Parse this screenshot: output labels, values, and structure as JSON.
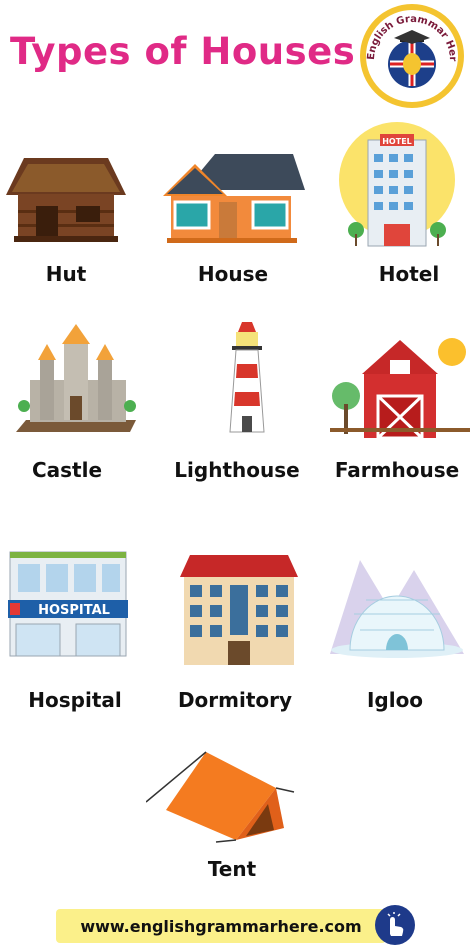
{
  "title": "Types of Houses",
  "logo": {
    "text": "English Grammar Here.Com"
  },
  "items": [
    {
      "label": "Hut",
      "icon": "hut-icon"
    },
    {
      "label": "House",
      "icon": "house-icon"
    },
    {
      "label": "Hotel",
      "icon": "hotel-icon",
      "sign": "HOTEL"
    },
    {
      "label": "Castle",
      "icon": "castle-icon"
    },
    {
      "label": "Lighthouse",
      "icon": "lighthouse-icon"
    },
    {
      "label": "Farmhouse",
      "icon": "farmhouse-icon"
    },
    {
      "label": "Hospital",
      "icon": "hospital-icon",
      "sign": "HOSPITAL"
    },
    {
      "label": "Dormitory",
      "icon": "dormitory-icon"
    },
    {
      "label": "Igloo",
      "icon": "igloo-icon"
    },
    {
      "label": "Tent",
      "icon": "tent-icon"
    }
  ],
  "footer": {
    "url": "www.englishgrammarhere.com"
  },
  "colors": {
    "title": "#e02a86",
    "footer_bg": "#fbf08a"
  }
}
